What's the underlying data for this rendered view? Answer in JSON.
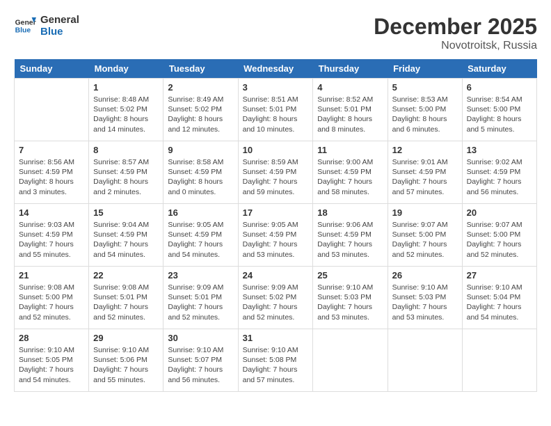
{
  "logo": {
    "general": "General",
    "blue": "Blue"
  },
  "title": "December 2025",
  "location": "Novotroitsk, Russia",
  "days": [
    "Sunday",
    "Monday",
    "Tuesday",
    "Wednesday",
    "Thursday",
    "Friday",
    "Saturday"
  ],
  "weeks": [
    [
      {
        "date": "",
        "info": ""
      },
      {
        "date": "1",
        "info": "Sunrise: 8:48 AM\nSunset: 5:02 PM\nDaylight: 8 hours\nand 14 minutes."
      },
      {
        "date": "2",
        "info": "Sunrise: 8:49 AM\nSunset: 5:02 PM\nDaylight: 8 hours\nand 12 minutes."
      },
      {
        "date": "3",
        "info": "Sunrise: 8:51 AM\nSunset: 5:01 PM\nDaylight: 8 hours\nand 10 minutes."
      },
      {
        "date": "4",
        "info": "Sunrise: 8:52 AM\nSunset: 5:01 PM\nDaylight: 8 hours\nand 8 minutes."
      },
      {
        "date": "5",
        "info": "Sunrise: 8:53 AM\nSunset: 5:00 PM\nDaylight: 8 hours\nand 6 minutes."
      },
      {
        "date": "6",
        "info": "Sunrise: 8:54 AM\nSunset: 5:00 PM\nDaylight: 8 hours\nand 5 minutes."
      }
    ],
    [
      {
        "date": "7",
        "info": "Sunrise: 8:56 AM\nSunset: 4:59 PM\nDaylight: 8 hours\nand 3 minutes."
      },
      {
        "date": "8",
        "info": "Sunrise: 8:57 AM\nSunset: 4:59 PM\nDaylight: 8 hours\nand 2 minutes."
      },
      {
        "date": "9",
        "info": "Sunrise: 8:58 AM\nSunset: 4:59 PM\nDaylight: 8 hours\nand 0 minutes."
      },
      {
        "date": "10",
        "info": "Sunrise: 8:59 AM\nSunset: 4:59 PM\nDaylight: 7 hours\nand 59 minutes."
      },
      {
        "date": "11",
        "info": "Sunrise: 9:00 AM\nSunset: 4:59 PM\nDaylight: 7 hours\nand 58 minutes."
      },
      {
        "date": "12",
        "info": "Sunrise: 9:01 AM\nSunset: 4:59 PM\nDaylight: 7 hours\nand 57 minutes."
      },
      {
        "date": "13",
        "info": "Sunrise: 9:02 AM\nSunset: 4:59 PM\nDaylight: 7 hours\nand 56 minutes."
      }
    ],
    [
      {
        "date": "14",
        "info": "Sunrise: 9:03 AM\nSunset: 4:59 PM\nDaylight: 7 hours\nand 55 minutes."
      },
      {
        "date": "15",
        "info": "Sunrise: 9:04 AM\nSunset: 4:59 PM\nDaylight: 7 hours\nand 54 minutes."
      },
      {
        "date": "16",
        "info": "Sunrise: 9:05 AM\nSunset: 4:59 PM\nDaylight: 7 hours\nand 54 minutes."
      },
      {
        "date": "17",
        "info": "Sunrise: 9:05 AM\nSunset: 4:59 PM\nDaylight: 7 hours\nand 53 minutes."
      },
      {
        "date": "18",
        "info": "Sunrise: 9:06 AM\nSunset: 4:59 PM\nDaylight: 7 hours\nand 53 minutes."
      },
      {
        "date": "19",
        "info": "Sunrise: 9:07 AM\nSunset: 5:00 PM\nDaylight: 7 hours\nand 52 minutes."
      },
      {
        "date": "20",
        "info": "Sunrise: 9:07 AM\nSunset: 5:00 PM\nDaylight: 7 hours\nand 52 minutes."
      }
    ],
    [
      {
        "date": "21",
        "info": "Sunrise: 9:08 AM\nSunset: 5:00 PM\nDaylight: 7 hours\nand 52 minutes."
      },
      {
        "date": "22",
        "info": "Sunrise: 9:08 AM\nSunset: 5:01 PM\nDaylight: 7 hours\nand 52 minutes."
      },
      {
        "date": "23",
        "info": "Sunrise: 9:09 AM\nSunset: 5:01 PM\nDaylight: 7 hours\nand 52 minutes."
      },
      {
        "date": "24",
        "info": "Sunrise: 9:09 AM\nSunset: 5:02 PM\nDaylight: 7 hours\nand 52 minutes."
      },
      {
        "date": "25",
        "info": "Sunrise: 9:10 AM\nSunset: 5:03 PM\nDaylight: 7 hours\nand 53 minutes."
      },
      {
        "date": "26",
        "info": "Sunrise: 9:10 AM\nSunset: 5:03 PM\nDaylight: 7 hours\nand 53 minutes."
      },
      {
        "date": "27",
        "info": "Sunrise: 9:10 AM\nSunset: 5:04 PM\nDaylight: 7 hours\nand 54 minutes."
      }
    ],
    [
      {
        "date": "28",
        "info": "Sunrise: 9:10 AM\nSunset: 5:05 PM\nDaylight: 7 hours\nand 54 minutes."
      },
      {
        "date": "29",
        "info": "Sunrise: 9:10 AM\nSunset: 5:06 PM\nDaylight: 7 hours\nand 55 minutes."
      },
      {
        "date": "30",
        "info": "Sunrise: 9:10 AM\nSunset: 5:07 PM\nDaylight: 7 hours\nand 56 minutes."
      },
      {
        "date": "31",
        "info": "Sunrise: 9:10 AM\nSunset: 5:08 PM\nDaylight: 7 hours\nand 57 minutes."
      },
      {
        "date": "",
        "info": ""
      },
      {
        "date": "",
        "info": ""
      },
      {
        "date": "",
        "info": ""
      }
    ]
  ]
}
